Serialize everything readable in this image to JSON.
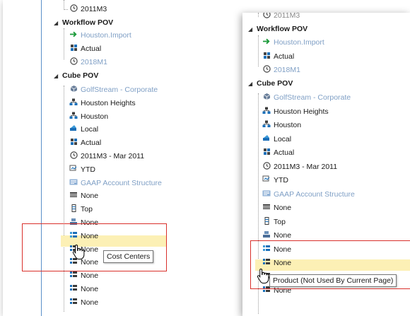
{
  "left": {
    "top_partial": "2011M3",
    "workflow_pov": "Workflow POV",
    "workflow_items": [
      "Houston.Import",
      "Actual",
      "2018M1"
    ],
    "cube_pov": "Cube POV",
    "cube_items": [
      "GolfStream - Corporate",
      "Houston Heights",
      "Houston",
      "Local",
      "Actual",
      "2011M3 - Mar 2011",
      "YTD",
      "GAAP Account Structure",
      "None",
      "Top",
      "None",
      "None",
      "None",
      "None",
      "None",
      "None",
      "None"
    ],
    "hover_partial": "ne",
    "tooltip": "Cost Centers"
  },
  "right": {
    "top_partial": "2011M3",
    "workflow_pov": "Workflow POV",
    "workflow_items": [
      "Houston.Import",
      "Actual",
      "2018M1"
    ],
    "cube_pov": "Cube POV",
    "cube_items": [
      "GolfStream - Corporate",
      "Houston Heights",
      "Houston",
      "Local",
      "Actual",
      "2011M3 - Mar 2011",
      "YTD",
      "GAAP Account Structure",
      "None",
      "Top",
      "None",
      "None",
      "None",
      "None",
      "None"
    ],
    "hover_partial": "Nor",
    "tooltip": "Product (Not Used By Current Page)"
  },
  "colors": {
    "highlight": "#fcf0b5",
    "callout": "#d9302b",
    "vline": "#5b8fc9",
    "dim_text": "#7f9fc5"
  }
}
